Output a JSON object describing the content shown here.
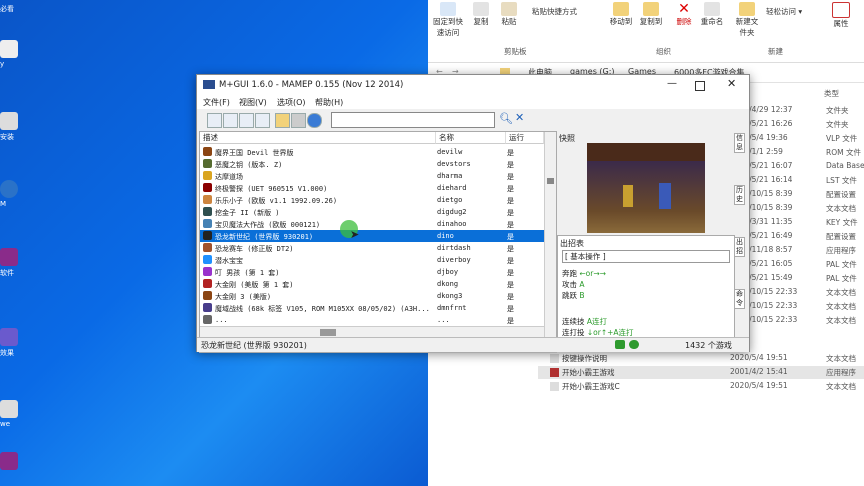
{
  "desktop": {
    "icons": [
      {
        "label": "必看",
        "color": "#c33"
      },
      {
        "label": "y",
        "color": "#eee"
      },
      {
        "label": "安装",
        "color": "#ddd"
      },
      {
        "label": "M",
        "color": "#2a72c8"
      },
      {
        "label": "软件",
        "color": "#8a2b8a"
      },
      {
        "label": "效果",
        "color": "#6a5acd"
      },
      {
        "label": "we",
        "color": "#ddd"
      }
    ]
  },
  "explorer": {
    "ribbon": {
      "buttons": [
        "固定到快速访问",
        "复制",
        "粘贴",
        "粘贴快捷方式",
        "移动到",
        "复制到",
        "删除",
        "重命名",
        "新建文件夹",
        "轻松访问",
        "属性"
      ],
      "groups": [
        "剪贴板",
        "组织",
        "新建"
      ]
    },
    "breadcrumbs": [
      "此电脑",
      "games (G:)",
      "Games",
      "6000多FC游戏合集"
    ],
    "columns": {
      "type": "类型"
    },
    "rows": [
      {
        "date": "2015/4/29 12:37",
        "type": "文件夹"
      },
      {
        "date": "2015/5/21 16:26",
        "type": "文件夹"
      },
      {
        "date": "2015/5/4 19:36",
        "type": "VLP 文件"
      },
      {
        "date": "2001/1/1 2:59",
        "type": "ROM 文件"
      },
      {
        "date": "2015/5/21 16:07",
        "type": "Data Base"
      },
      {
        "date": "2015/5/21 16:14",
        "type": "LST 文件"
      },
      {
        "date": "2015/10/15 8:39",
        "type": "配置设置"
      },
      {
        "date": "2015/10/15 8:39",
        "type": "文本文档"
      },
      {
        "date": "2015/3/31 11:35",
        "type": "KEY 文件"
      },
      {
        "date": "2015/5/21 16:49",
        "type": "配置设置"
      },
      {
        "date": "2012/11/18 8:57",
        "type": "应用程序"
      },
      {
        "date": "2015/5/21 16:05",
        "type": "PAL 文件"
      },
      {
        "date": "2015/5/21 15:49",
        "type": "PAL 文件"
      },
      {
        "date": "2015/10/15 22:33",
        "type": "文本文档"
      },
      {
        "date": "2015/10/15 22:33",
        "type": "文本文档"
      },
      {
        "date": "2015/10/15 22:33",
        "type": "文本文档"
      }
    ],
    "named_rows": [
      {
        "name": "按键操作说明",
        "date": "2020/5/4 19:51",
        "type": "文本文档"
      },
      {
        "name": "开始小霸王游戏",
        "date": "2001/4/2 15:41",
        "type": "应用程序"
      },
      {
        "name": "开始小霸王游戏C",
        "date": "2020/5/4 19:51",
        "type": "文本文档"
      }
    ]
  },
  "app": {
    "title": "M+GUI 1.6.0 - MAMEP 0.155 (Nov 12 2014)",
    "menus": [
      "文件(F)",
      "视图(V)",
      "选项(O)",
      "帮助(H)"
    ],
    "columns": {
      "desc": "描述",
      "name": "名称",
      "work": "运行"
    },
    "games": [
      {
        "desc": "魔界王国 Devil 世界版",
        "name": "devilw",
        "work": "是",
        "color": "#8b4513"
      },
      {
        "desc": "恶魔之钥 (版本. Z)",
        "name": "devstors",
        "work": "是",
        "color": "#556b2f"
      },
      {
        "desc": "达摩道场",
        "name": "dharma",
        "work": "是",
        "color": "#daa520"
      },
      {
        "desc": "终极警探 (UET 960515 V1.000)",
        "name": "diehard",
        "work": "是",
        "color": "#8b0000"
      },
      {
        "desc": "乐乐小子 (欧版 v1.1 1992.09.26)",
        "name": "dietgo",
        "work": "是",
        "color": "#cd853f"
      },
      {
        "desc": "挖金子 II (新版 )",
        "name": "digdug2",
        "work": "是",
        "color": "#2f4f4f"
      },
      {
        "desc": "宝贝魔法大作战 (欧版 000121)",
        "name": "dinahoo",
        "work": "是",
        "color": "#4682b4"
      },
      {
        "desc": "恐龙新世纪 (世界版 930201)",
        "name": "dino",
        "work": "是",
        "color": "#222222"
      },
      {
        "desc": "恐龙赛车 (修正版 DT2)",
        "name": "dirtdash",
        "work": "是",
        "color": "#a0522d"
      },
      {
        "desc": "潜水宝宝",
        "name": "diverboy",
        "work": "是",
        "color": "#1e90ff"
      },
      {
        "desc": "叮 男孩 (第 1 套)",
        "name": "djboy",
        "work": "是",
        "color": "#9932cc"
      },
      {
        "desc": "大金刚 (美版 第 1 套)",
        "name": "dkong",
        "work": "是",
        "color": "#b22222"
      },
      {
        "desc": "大金刚 3 (美版)",
        "name": "dkong3",
        "work": "是",
        "color": "#8b4513"
      },
      {
        "desc": "魔域战线 (68k 标签 V105, ROM M105XX 08/05/02) (A3H...",
        "name": "dmnfrnt",
        "work": "是",
        "color": "#483d8b"
      },
      {
        "desc": "...",
        "name": "...",
        "work": "是",
        "color": "#666666"
      }
    ],
    "status": {
      "selected": "恐龙新世纪 (世界版 930201)",
      "count": "1432 个游戏"
    },
    "snapshot_label": "快照",
    "moves": {
      "label": "出招表",
      "mode": "[ 基本操作 ]",
      "lines": [
        {
          "k": "奔跑",
          "v": "←or→→"
        },
        {
          "k": "攻击",
          "v": "A"
        },
        {
          "k": "跳跃",
          "v": "B"
        },
        {
          "k": "连续技",
          "v": "A连打"
        },
        {
          "k": "连打投",
          "v": "↓or↑+A连打"
        }
      ]
    },
    "side_tabs": [
      "信息",
      "历史",
      "出招",
      "命令"
    ]
  }
}
